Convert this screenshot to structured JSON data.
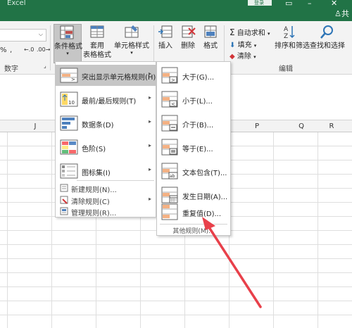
{
  "window": {
    "title": "Excel",
    "signin_label": "登录",
    "share_label": "共"
  },
  "ribbon": {
    "number_format_row": [
      "%",
      ",",
      "←.0",
      ".00→"
    ],
    "group_number": "数字",
    "conditional_format": "条件格式",
    "table_format_line1": "套用",
    "table_format_line2": "表格格式",
    "cell_style": "单元格样式",
    "insert": "插入",
    "delete": "删除",
    "format": "格式",
    "autosum": "自动求和",
    "fill": "填充",
    "clear": "清除",
    "sort_filter": "排序和筛选",
    "find_select": "查找和选择",
    "group_edit": "编辑"
  },
  "columns": [
    "J",
    "P",
    "Q",
    "R"
  ],
  "menu_main": {
    "items": [
      {
        "label": "突出显示单元格规则(H)",
        "icon": "highlight-cells-icon",
        "highlighted": true
      },
      {
        "label": "最前/最后规则(T)",
        "icon": "top-bottom-icon"
      },
      {
        "label": "数据条(D)",
        "icon": "data-bars-icon"
      },
      {
        "label": "色阶(S)",
        "icon": "color-scale-icon"
      },
      {
        "label": "图标集(I)",
        "icon": "icon-sets-icon"
      }
    ],
    "actions": [
      {
        "label": "新建规则(N)...",
        "icon": "new-rule-icon"
      },
      {
        "label": "清除规则(C)",
        "icon": "clear-rules-icon"
      },
      {
        "label": "管理规则(R)...",
        "icon": "manage-rules-icon"
      }
    ]
  },
  "menu_sub": {
    "items": [
      {
        "label": "大于(G)...",
        "icon": "greater-than-icon"
      },
      {
        "label": "小于(L)...",
        "icon": "less-than-icon"
      },
      {
        "label": "介于(B)...",
        "icon": "between-icon"
      },
      {
        "label": "等于(E)...",
        "icon": "equal-to-icon"
      },
      {
        "label": "文本包含(T)...",
        "icon": "text-contains-icon"
      },
      {
        "label": "发生日期(A)...",
        "icon": "date-occurring-icon"
      },
      {
        "label": "重复值(D)...",
        "icon": "duplicate-values-icon"
      }
    ],
    "more_rules": "其他规则(M)..."
  },
  "colors": {
    "accent": "#217346",
    "highlight": "#c6c6c6",
    "annotation_arrow": "#e8404a"
  }
}
